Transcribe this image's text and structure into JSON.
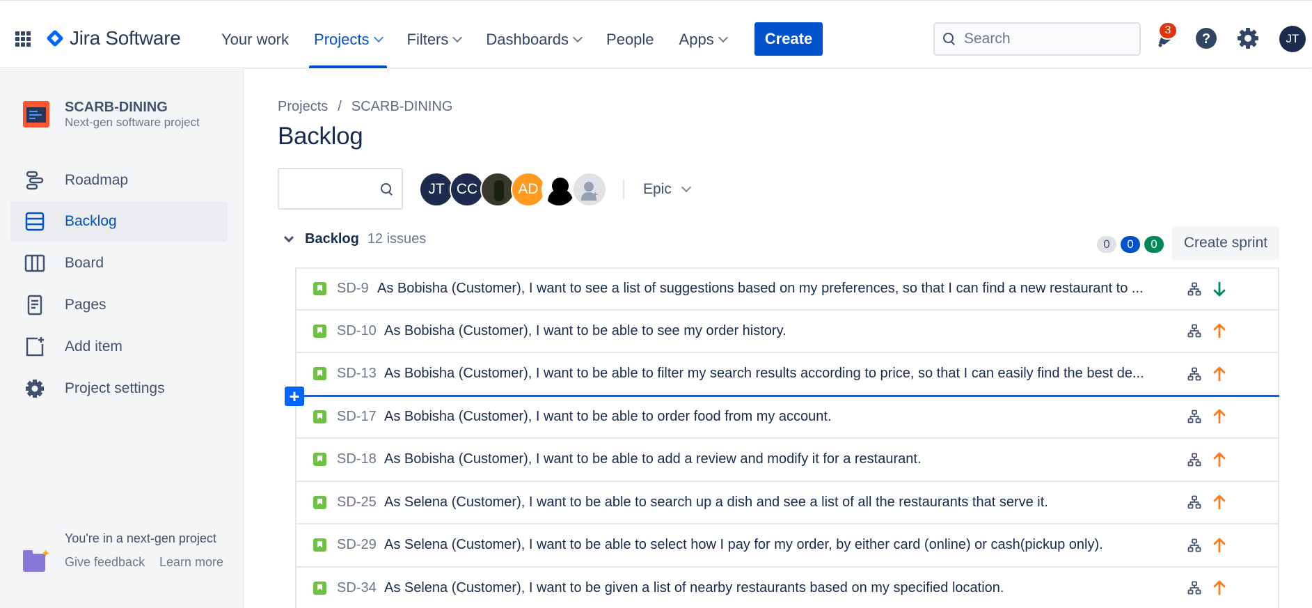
{
  "topnav": {
    "logo_text": "Jira Software",
    "items": [
      {
        "label": "Your work"
      },
      {
        "label": "Projects"
      },
      {
        "label": "Filters"
      },
      {
        "label": "Dashboards"
      },
      {
        "label": "People"
      },
      {
        "label": "Apps"
      }
    ],
    "create_label": "Create",
    "search_placeholder": "Search",
    "notification_count": "3",
    "user_initials": "JT"
  },
  "sidebar": {
    "project_name": "SCARB-DINING",
    "project_type": "Next-gen software project",
    "items": [
      {
        "label": "Roadmap"
      },
      {
        "label": "Backlog"
      },
      {
        "label": "Board"
      },
      {
        "label": "Pages"
      },
      {
        "label": "Add item"
      },
      {
        "label": "Project settings"
      }
    ],
    "footer": {
      "text": "You're in a next-gen project",
      "feedback": "Give feedback",
      "learn": "Learn more"
    }
  },
  "main": {
    "breadcrumb": [
      "Projects",
      "/",
      "SCARB-DINING"
    ],
    "title": "Backlog",
    "avatars": [
      "JT",
      "CC",
      "AD"
    ],
    "epic_label": "Epic",
    "backlog": {
      "title": "Backlog",
      "count": "12 issues",
      "status_counts": [
        "0",
        "0",
        "0"
      ],
      "create_sprint": "Create sprint",
      "issues": [
        {
          "key": "SD-9",
          "summary": "As Bobisha (Customer), I want to see a list of suggestions based on my preferences, so that I can find a new restaurant to ...",
          "priority": "low"
        },
        {
          "key": "SD-10",
          "summary": "As Bobisha (Customer), I want to be able to see my order history.",
          "priority": "high"
        },
        {
          "key": "SD-13",
          "summary": "As Bobisha (Customer), I want to be able to filter my search results according to price, so that I can easily find the best de...",
          "priority": "high"
        },
        {
          "key": "SD-17",
          "summary": "As Bobisha (Customer), I want to be able to order food from my account.",
          "priority": "high"
        },
        {
          "key": "SD-18",
          "summary": "As Bobisha (Customer), I want to be able to add a review and modify it for a restaurant.",
          "priority": "high"
        },
        {
          "key": "SD-25",
          "summary": "As Selena (Customer), I want to be able to search up a dish and see a list of all the restaurants that serve it.",
          "priority": "high"
        },
        {
          "key": "SD-29",
          "summary": "As Selena (Customer), I want to be able to select how I pay for my order, by either card (online) or cash(pickup only).",
          "priority": "high"
        },
        {
          "key": "SD-34",
          "summary": "As Selena (Customer), I want to be given a list of nearby restaurants based on my specified location.",
          "priority": "high"
        }
      ]
    }
  },
  "colors": {
    "brand_blue": "#0052cc",
    "story_green": "#6ec242",
    "priority_high": "#ff7a1a",
    "priority_low": "#00875a"
  }
}
